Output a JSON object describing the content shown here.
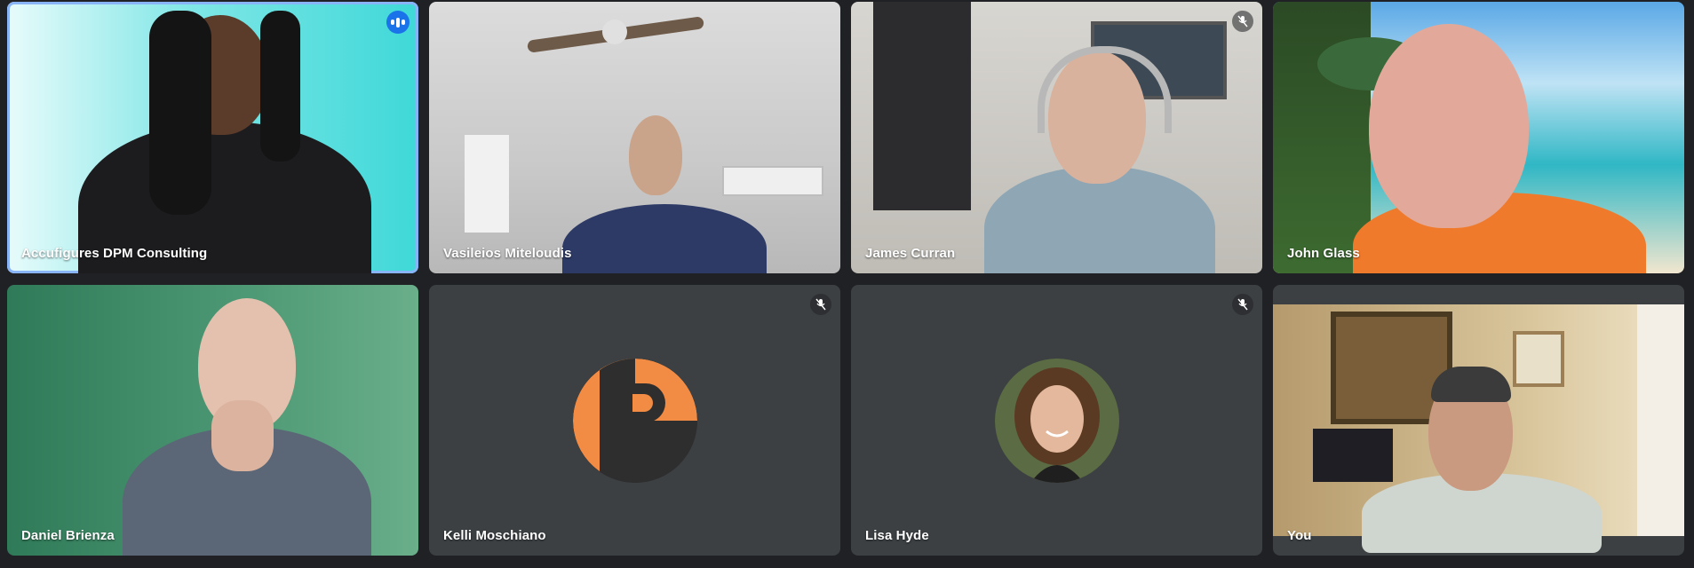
{
  "participants": [
    {
      "name": "Accufigures DPM Consulting",
      "muted": false,
      "speaking": true
    },
    {
      "name": "Vasileios Miteloudis",
      "muted": false,
      "speaking": false
    },
    {
      "name": "James Curran",
      "muted": true,
      "speaking": false
    },
    {
      "name": "John Glass",
      "muted": false,
      "speaking": false
    },
    {
      "name": "Daniel Brienza",
      "muted": false,
      "speaking": false
    },
    {
      "name": "Kelli Moschiano",
      "muted": true,
      "speaking": false,
      "avatar_letter": "P",
      "avatar_color": "#f28c45"
    },
    {
      "name": "Lisa Hyde",
      "muted": true,
      "speaking": false
    },
    {
      "name": "You",
      "muted": false,
      "speaking": false
    }
  ],
  "icons": {
    "mute": "mic-off-icon",
    "speaking": "audio-level-icon"
  },
  "colors": {
    "background": "#202124",
    "tile": "#3c4043",
    "active_outline": "#8ab4f8",
    "speaking_badge": "#1a73e8"
  }
}
